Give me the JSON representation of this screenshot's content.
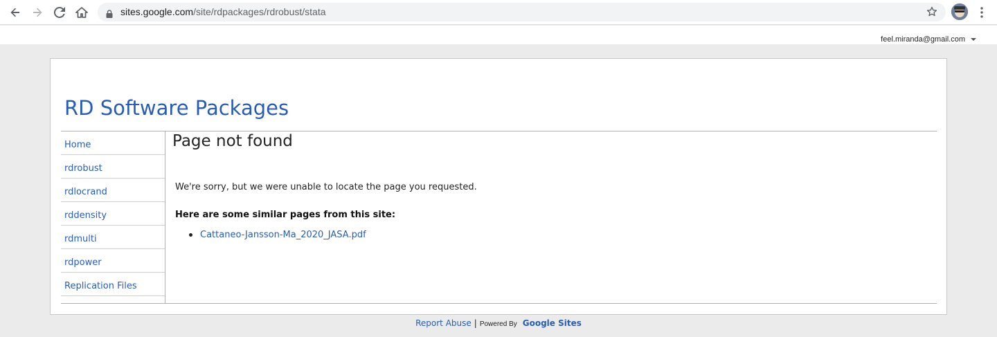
{
  "browser": {
    "url_domain": "sites.google.com",
    "url_path": "/site/rdpackages/rdrobust/stata",
    "icons": [
      "back-arrow-icon",
      "forward-arrow-icon",
      "reload-icon",
      "home-icon",
      "lock-icon",
      "star-icon",
      "kebab-menu-icon"
    ]
  },
  "account": {
    "email": "feel.miranda@gmail.com"
  },
  "site": {
    "title": "RD Software Packages"
  },
  "sidebar": {
    "items": [
      {
        "label": "Home"
      },
      {
        "label": "rdrobust"
      },
      {
        "label": "rdlocrand"
      },
      {
        "label": "rddensity"
      },
      {
        "label": "rdmulti"
      },
      {
        "label": "rdpower"
      },
      {
        "label": "Replication Files"
      }
    ]
  },
  "main": {
    "heading": "Page not found",
    "message": "We're sorry, but we were unable to locate the page you requested.",
    "similar_heading": "Here are some similar pages from this site:",
    "similar_pages": [
      {
        "label": "Cattaneo-Jansson-Ma_2020_JASA.pdf"
      }
    ]
  },
  "footer": {
    "report_abuse": "Report Abuse",
    "separator": "|",
    "powered_by": "Powered By",
    "google_sites": "Google Sites"
  },
  "colors": {
    "link": "#2a5db0",
    "page_background": "#ebebeb"
  }
}
